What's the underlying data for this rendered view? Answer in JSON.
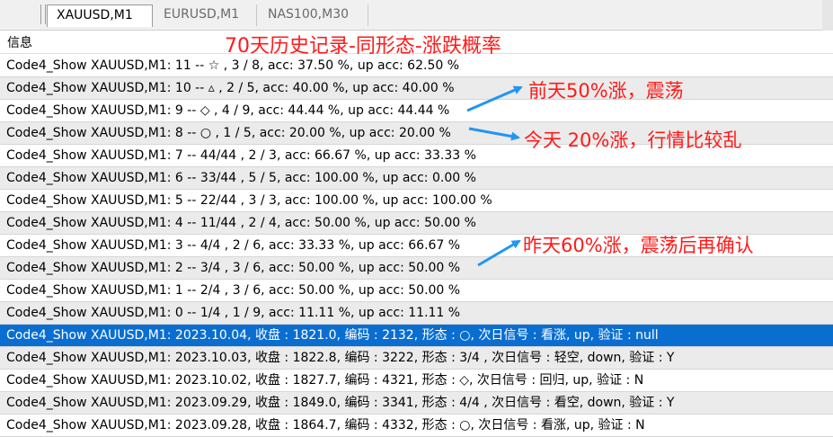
{
  "tabs": [
    {
      "label": "XAUUSD,M1",
      "active": true
    },
    {
      "label": "EURUSD,M1",
      "active": false
    },
    {
      "label": "NAS100,M30",
      "active": false
    }
  ],
  "header": {
    "column": "信息"
  },
  "annotations": {
    "title": "70天历史记录-同形态-涨跌概率",
    "note1": "前天50%涨，震荡",
    "note2": "今天 20%涨，行情比较乱",
    "note3": "昨天60%涨，震荡后再确认"
  },
  "rows": [
    "Code4_Show XAUUSD,M1: 11 -- ☆ , 3 / 8, acc: 37.50 %, up acc: 62.50 %",
    "Code4_Show XAUUSD,M1: 10 -- ▵ , 2 / 5, acc: 40.00 %, up acc: 40.00 %",
    "Code4_Show XAUUSD,M1: 9 -- ◇ , 4 / 9, acc: 44.44 %, up acc: 44.44 %",
    "Code4_Show XAUUSD,M1: 8 -- ○ , 1 / 5, acc: 20.00 %, up acc: 20.00 %",
    "Code4_Show XAUUSD,M1: 7 -- 44/44 , 2 / 3, acc: 66.67 %, up acc: 33.33 %",
    "Code4_Show XAUUSD,M1: 6 -- 33/44 , 5 / 5, acc: 100.00 %, up acc: 0.00 %",
    "Code4_Show XAUUSD,M1: 5 -- 22/44 , 3 / 3, acc: 100.00 %, up acc: 100.00 %",
    "Code4_Show XAUUSD,M1: 4 -- 11/44 , 2 / 4, acc: 50.00 %, up acc: 50.00 %",
    "Code4_Show XAUUSD,M1: 3 -- 4/4 , 2 / 6, acc: 33.33 %, up acc: 66.67 %",
    "Code4_Show XAUUSD,M1: 2 -- 3/4 , 3 / 6, acc: 50.00 %, up acc: 50.00 %",
    "Code4_Show XAUUSD,M1: 1 -- 2/4 , 3 / 6, acc: 50.00 %, up acc: 50.00 %",
    "Code4_Show XAUUSD,M1: 0 -- 1/4 , 1 / 9, acc: 11.11 %, up acc: 11.11 %",
    "Code4_Show XAUUSD,M1: 2023.10.04, 收盘 : 1821.0, 编码 : 2132, 形态 : ○, 次日信号 : 看涨, up, 验证 : null",
    "Code4_Show XAUUSD,M1: 2023.10.03, 收盘 : 1822.8, 编码 : 3222, 形态 : 3/4 , 次日信号 : 轻空, down, 验证 : Y",
    "Code4_Show XAUUSD,M1: 2023.10.02, 收盘 : 1827.7, 编码 : 4321, 形态 : ◇, 次日信号 : 回归, up, 验证 : N",
    "Code4_Show XAUUSD,M1: 2023.09.29, 收盘 : 1849.0, 编码 : 3341, 形态 : 4/4 , 次日信号 : 看空, down, 验证 : Y",
    "Code4_Show XAUUSD,M1: 2023.09.28, 收盘 : 1864.7, 编码 : 4332, 形态 : ○, 次日信号 : 看涨, up, 验证 : N"
  ],
  "selected_row": 12,
  "colors": {
    "selection": "#0a6ed1",
    "annotation": "#ff1a1a",
    "arrow": "#2196f3"
  }
}
